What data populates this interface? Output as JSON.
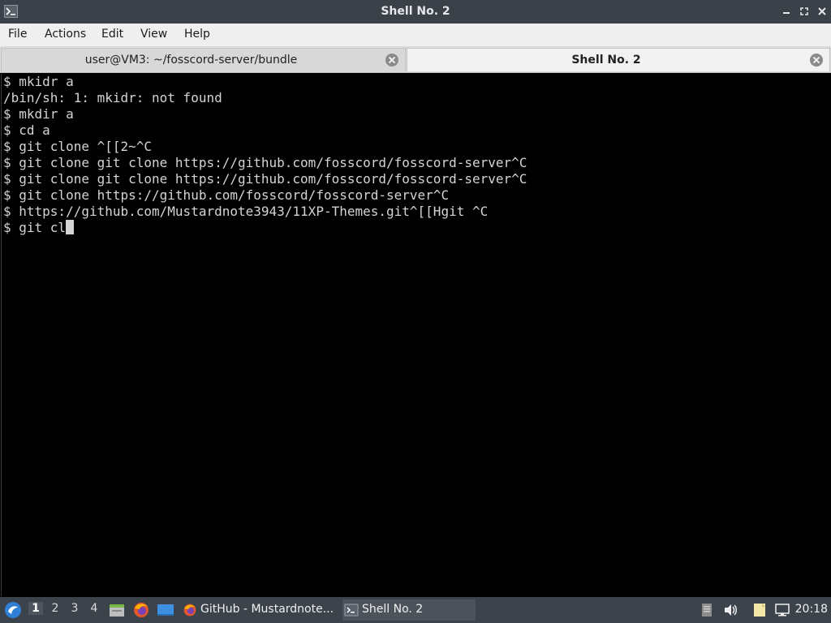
{
  "window": {
    "title": "Shell No. 2"
  },
  "menu": {
    "items": [
      "File",
      "Actions",
      "Edit",
      "View",
      "Help"
    ]
  },
  "tabs": [
    {
      "label": "user@VM3: ~/fosscord-server/bundle",
      "active": false
    },
    {
      "label": "Shell No. 2",
      "active": true
    }
  ],
  "terminal": {
    "lines": [
      "$ mkidr a",
      "/bin/sh: 1: mkidr: not found",
      "$ mkdir a",
      "$ cd a",
      "$ git clone ^[[2~^C",
      "$ git clone git clone https://github.com/fosscord/fosscord-server^C",
      "$ git clone git clone https://github.com/fosscord/fosscord-server^C",
      "$ git clone https://github.com/fosscord/fosscord-server^C",
      "$ https://github.com/Mustardnote3943/11XP-Themes.git^[[Hgit ^C"
    ],
    "current_input": "$ git cl"
  },
  "taskbar": {
    "workspaces": [
      "1",
      "2",
      "3",
      "4"
    ],
    "active_workspace": "1",
    "launchers": [
      "file-manager-icon",
      "firefox-icon",
      "desktop-icon"
    ],
    "tasks": [
      {
        "label": "GitHub - Mustardnote...",
        "icon": "firefox-icon",
        "active": false
      },
      {
        "label": "Shell No. 2",
        "icon": "terminal-icon",
        "active": true
      }
    ],
    "tray": [
      "clipboard-icon",
      "volume-icon",
      "notes-icon",
      "network-icon"
    ],
    "clock": "20:18"
  },
  "colors": {
    "titlebar": "#3b4149",
    "terminal_bg": "#000000",
    "terminal_fg": "#d4d4d4",
    "taskbar": "#3c434b"
  }
}
